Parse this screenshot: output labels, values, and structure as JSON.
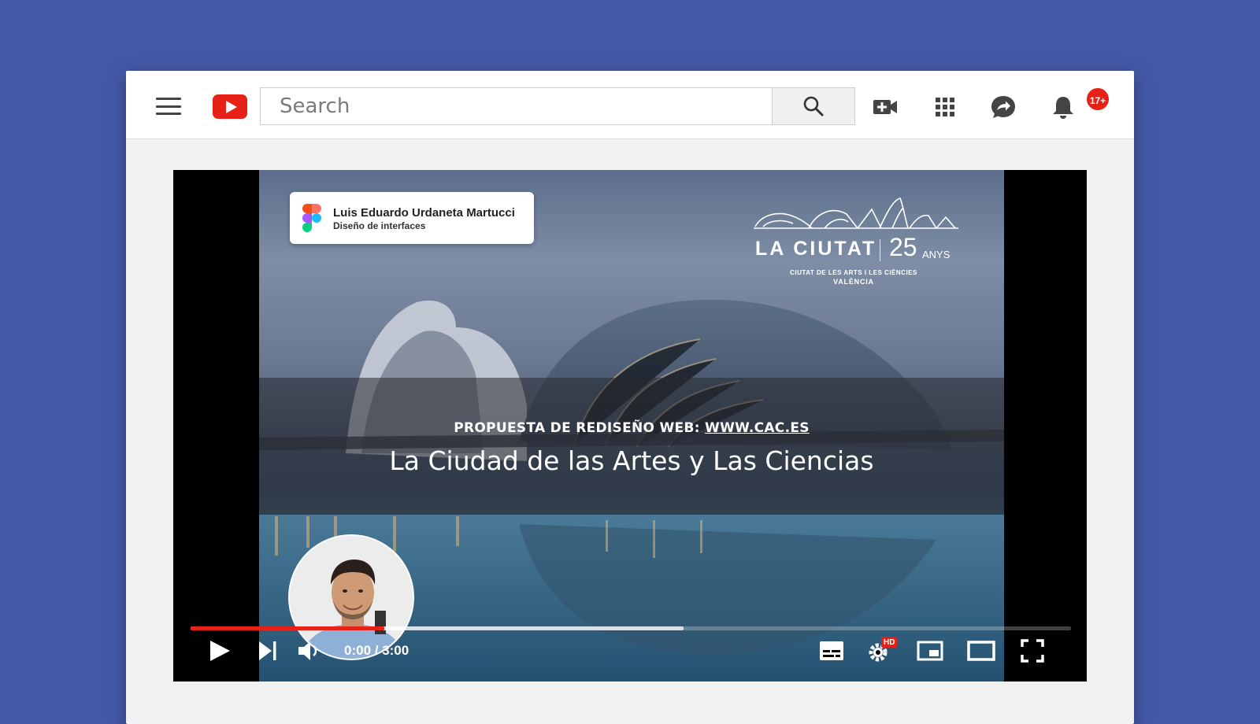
{
  "search": {
    "placeholder": "Search"
  },
  "notifications": {
    "badge": "17+"
  },
  "video": {
    "author_card": {
      "name": "Luis Eduardo Urdaneta Martucci",
      "role": "Diseño de interfaces"
    },
    "brand": {
      "name": "LA CIUTAT",
      "number": "25",
      "unit": "ANYS",
      "subtitle": "CIUTAT DE LES ARTS I LES CIÈNCIES",
      "city": "VALÈNCIA"
    },
    "subtitle_prefix": "PROPUESTA DE REDISEÑO WEB:",
    "subtitle_link": "WWW.CAC.ES",
    "title": "La Ciudad de las Artes y Las Ciencias"
  },
  "player": {
    "time": "0:00 / 3:00",
    "hd_label": "HD",
    "progress": {
      "played": 0.22,
      "buffered": 0.56
    }
  },
  "colors": {
    "background": "#4459a8",
    "youtube_red": "#e62117"
  }
}
